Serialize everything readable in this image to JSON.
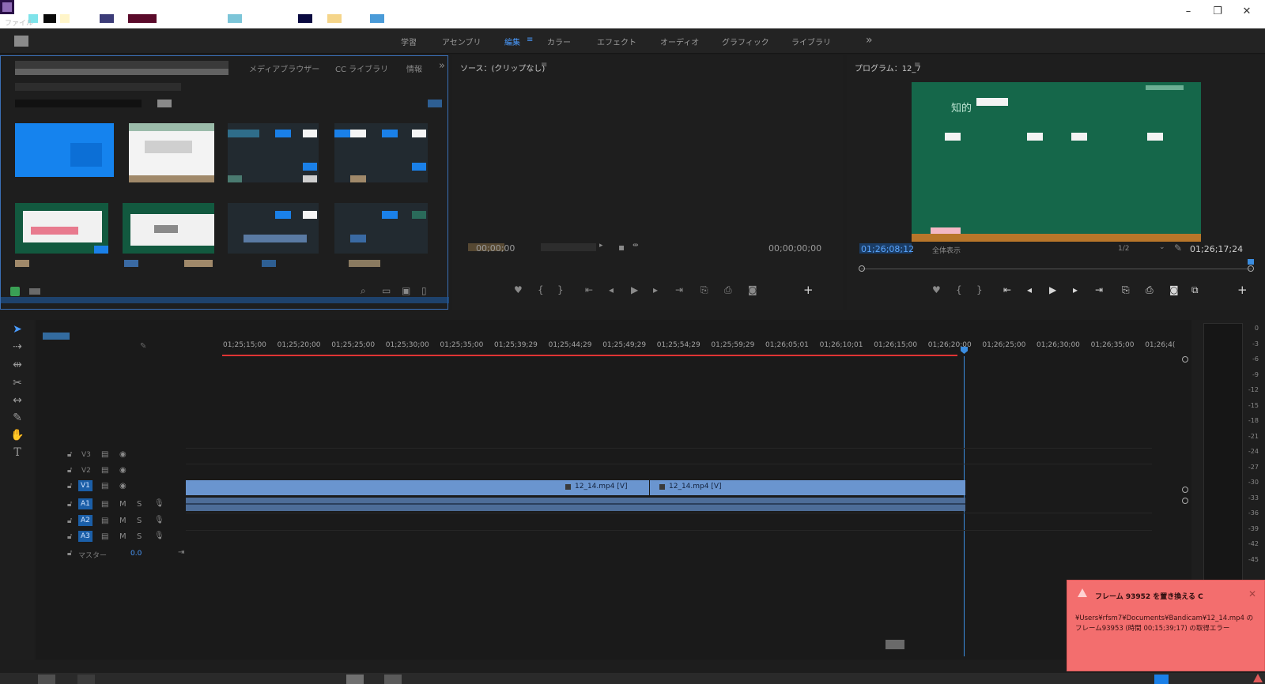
{
  "titlebar": {
    "menu_file": "ファイル",
    "controls": {
      "minimize": "–",
      "restore": "❐",
      "close": "✕"
    }
  },
  "workspace": {
    "tabs": [
      {
        "label": "学習"
      },
      {
        "label": "アセンブリ"
      },
      {
        "label": "編集",
        "active": true
      },
      {
        "label": "カラー"
      },
      {
        "label": "エフェクト"
      },
      {
        "label": "オーディオ"
      },
      {
        "label": "グラフィック"
      },
      {
        "label": "ライブラリ"
      }
    ],
    "menu_glyph": "≡",
    "more": "»"
  },
  "project_panel": {
    "tabs": [
      "メディアブラウザー",
      "CC ライブラリ",
      "情報"
    ],
    "more": "»"
  },
  "source_monitor": {
    "title": "ソース：(クリップなし)",
    "menu_glyph": "≡",
    "timecode_left": "00;00;00",
    "timecode_right": "00;00;00;00"
  },
  "program_monitor": {
    "title": "プログラム：12_7",
    "menu_glyph": "≡",
    "timecode_left": "01;26;08;12",
    "fit_label": "全体表示",
    "resolution": "1/2",
    "timecode_right": "01;26;17;24",
    "video_text": "知的"
  },
  "timeline": {
    "ruler_labels": [
      "01;25;15;00",
      "01;25;20;00",
      "01;25;25;00",
      "01;25;30;00",
      "01;25;35;00",
      "01;25;39;29",
      "01;25;44;29",
      "01;25;49;29",
      "01;25;54;29",
      "01;25;59;29",
      "01;26;05;01",
      "01;26;10;01",
      "01;26;15;00",
      "01;26;20;00",
      "01;26;25;00",
      "01;26;30;00",
      "01;26;35;00",
      "01;26;4("
    ],
    "video_tracks": [
      "V3",
      "V2",
      "V1"
    ],
    "audio_tracks": [
      "A1",
      "A2",
      "A3"
    ],
    "master_label": "マスター",
    "master_value": "0.0",
    "mute": "M",
    "solo": "S",
    "clips": [
      "12_14.mp4 [V]",
      "12_14.mp4 [V]"
    ]
  },
  "meters": {
    "scale": [
      "0",
      "-3",
      "-6",
      "-9",
      "-12",
      "-15",
      "-18",
      "-21",
      "-24",
      "-27",
      "-30",
      "-33",
      "-36",
      "-39",
      "-42",
      "-45"
    ]
  },
  "notification": {
    "title": "フレーム 93952 を置き換える C",
    "body": "¥Users¥rfsm7¥Documents¥Bandicam¥12_14.mp4 の フレーム93953 (時間 00;15;39;17) の取得エラー"
  },
  "colors": {
    "accent": "#4a9bff",
    "playhead": "#3b8de0",
    "clip": "#6a95cf",
    "alert": "#f36e6e"
  }
}
